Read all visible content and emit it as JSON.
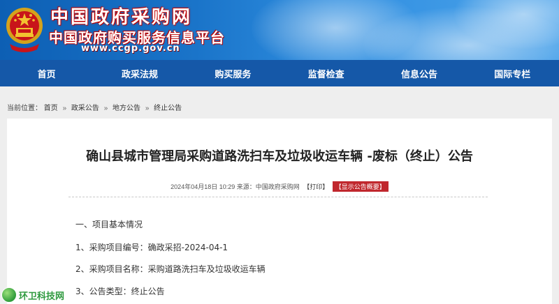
{
  "header": {
    "title": "中国政府采购网",
    "subtitle": "中国政府购买服务信息平台",
    "url": "www.ccgp.gov.cn",
    "emblem_icon": "national-emblem-icon",
    "colors": {
      "banner": "#1a74c9",
      "nav": "#1558a8",
      "title_outline": "#b00000"
    }
  },
  "nav": {
    "items": [
      {
        "label": "首页"
      },
      {
        "label": "政采法规"
      },
      {
        "label": "购买服务"
      },
      {
        "label": "监督检查"
      },
      {
        "label": "信息公告"
      },
      {
        "label": "国际专栏"
      }
    ]
  },
  "breadcrumb": {
    "prefix": "当前位置：",
    "items": [
      "首页",
      "政采公告",
      "地方公告",
      "终止公告"
    ],
    "separator": "»"
  },
  "article": {
    "title": "确山县城市管理局采购道路洗扫车及垃圾收运车辆 -废标（终止）公告",
    "meta_text": "2024年04月18日 10:29 来源：中国政府采购网",
    "print_label": "【打印】",
    "summary_label": "【显示公告概要】",
    "summary_color": "#c0272d",
    "lines": [
      "一、项目基本情况",
      "1、采购项目编号：确政采招-2024-04-1",
      "2、采购项目名称：采购道路洗扫车及垃圾收运车辆",
      "3、公告类型：终止公告"
    ]
  },
  "watermark": {
    "text": "环卫科技网",
    "logo_icon": "eco-leaf-logo-icon"
  }
}
